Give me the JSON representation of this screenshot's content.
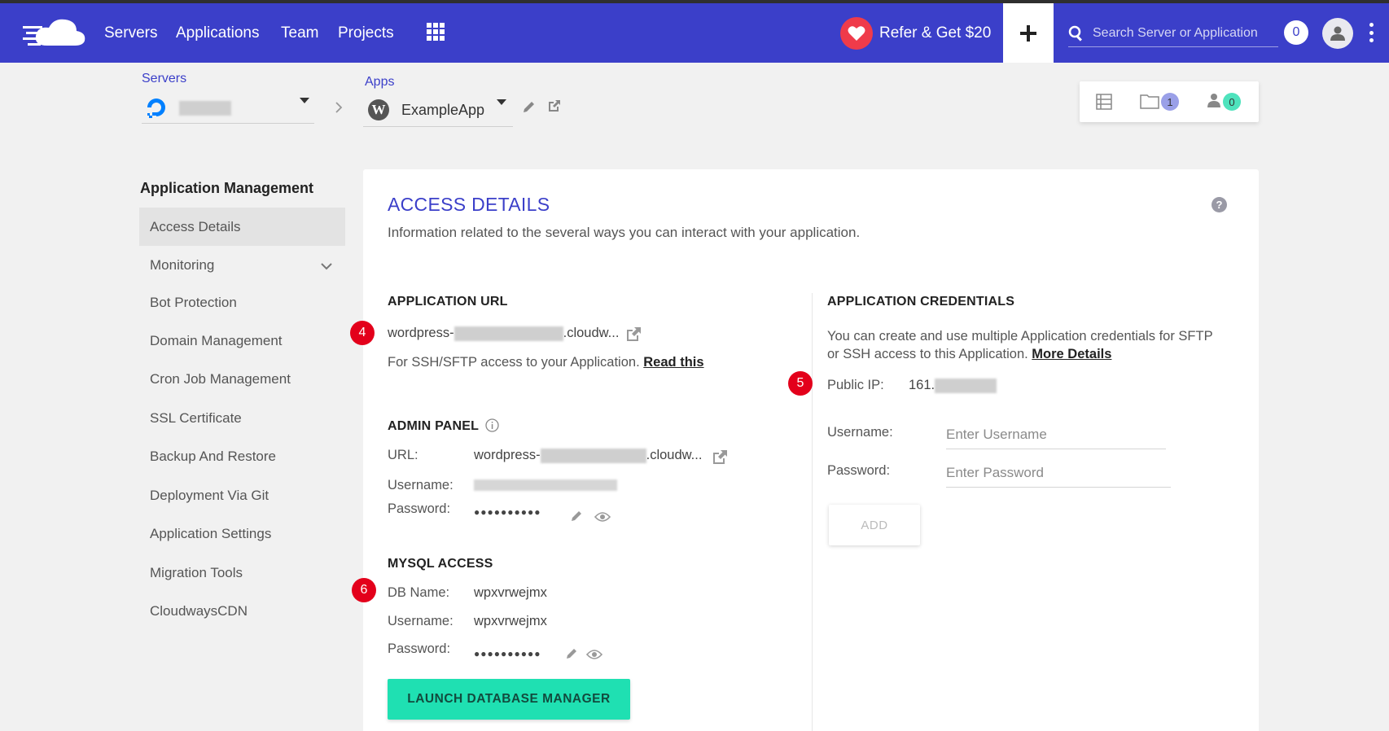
{
  "nav": {
    "items": [
      "Servers",
      "Applications",
      "Team",
      "Projects"
    ],
    "refer_label": "Refer & Get $20",
    "search_placeholder": "Search Server or Application",
    "notification_count": "0"
  },
  "selectors": {
    "servers_label": "Servers",
    "apps_label": "Apps",
    "app_name": "ExampleApp"
  },
  "quick_panel": {
    "files_count": "1",
    "users_count": "0"
  },
  "sidebar": {
    "title": "Application Management",
    "items": [
      "Access Details",
      "Monitoring",
      "Bot Protection",
      "Domain Management",
      "Cron Job Management",
      "SSL Certificate",
      "Backup And Restore",
      "Deployment Via Git",
      "Application Settings",
      "Migration Tools",
      "CloudwaysCDN"
    ],
    "active": "Access Details"
  },
  "main": {
    "title": "ACCESS DETAILS",
    "subtitle": "Information related to the several ways you can interact with your application.",
    "app_url": {
      "title": "APPLICATION URL",
      "url_prefix": "wordpress-",
      "url_suffix": ".cloudw...",
      "ssh_text": "For SSH/SFTP access to your Application.",
      "read_this": "Read this"
    },
    "admin_panel": {
      "title": "ADMIN PANEL",
      "url_label": "URL:",
      "url_prefix": "wordpress-",
      "url_suffix": ".cloudw...",
      "username_label": "Username:",
      "password_label": "Password:",
      "password_mask": "●●●●●●●●●●"
    },
    "mysql": {
      "title": "MYSQL ACCESS",
      "db_name_label": "DB Name:",
      "db_name": "wpxvrwejmx",
      "username_label": "Username:",
      "username": "wpxvrwejmx",
      "password_label": "Password:",
      "password_mask": "●●●●●●●●●●",
      "launch_label": "LAUNCH DATABASE MANAGER"
    },
    "credentials": {
      "title": "APPLICATION CREDENTIALS",
      "description_line1": "You can create and use multiple Application credentials for SFTP",
      "description_line2": "or SSH access to this Application.",
      "more_details": "More Details",
      "public_ip_label": "Public IP:",
      "public_ip_prefix": "161.",
      "username_label": "Username:",
      "username_placeholder": "Enter Username",
      "password_label": "Password:",
      "password_placeholder": "Enter Password",
      "add_label": "ADD"
    },
    "steps": [
      "4",
      "5",
      "6"
    ]
  },
  "colors": {
    "brand": "#3b3fc9",
    "accent_green": "#1fe0b2",
    "step_red": "#e3001b",
    "heart_red": "#ef3b4a"
  }
}
